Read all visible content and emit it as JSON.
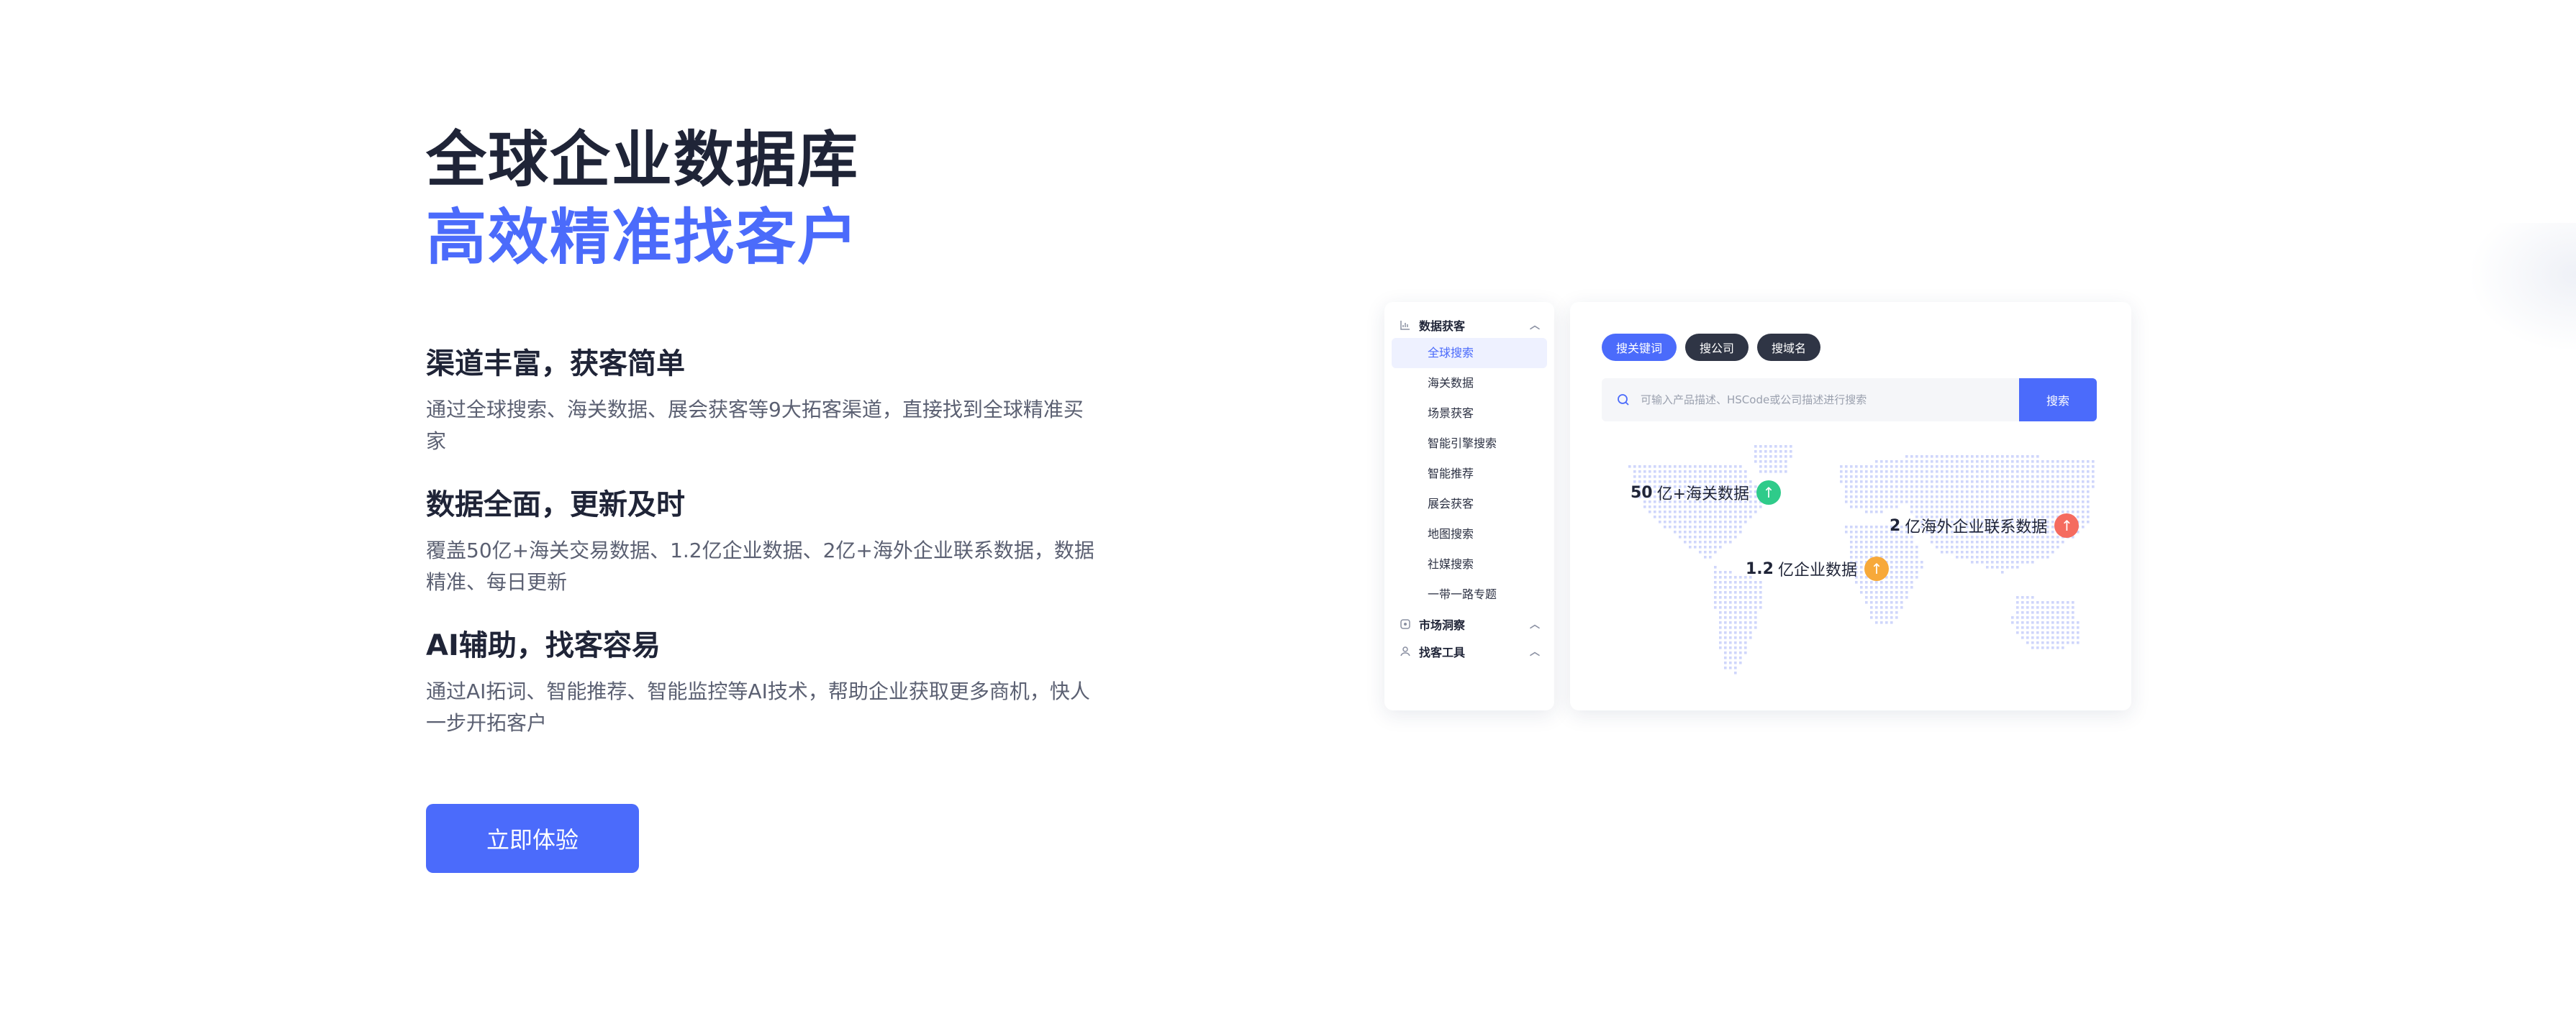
{
  "hero": {
    "title_line1": "全球企业数据库",
    "title_line2": "高效精准找客户",
    "cta_label": "立即体验"
  },
  "features": [
    {
      "title": "渠道丰富，获客简单",
      "desc": "通过全球搜索、海关数据、展会获客等9大拓客渠道，直接找到全球精准买家"
    },
    {
      "title": "数据全面，更新及时",
      "desc": "覆盖50亿+海关交易数据、1.2亿企业数据、2亿+海外企业联系数据，数据精准、每日更新"
    },
    {
      "title": "AI辅助，找客容易",
      "desc": "通过AI拓词、智能推荐、智能监控等AI技术，帮助企业获取更多商机，快人一步开拓客户"
    }
  ],
  "sidebar": {
    "group1": {
      "label": "数据获客",
      "icon": "bar-chart-icon"
    },
    "items": [
      "全球搜索",
      "海关数据",
      "场景获客",
      "智能引擎搜索",
      "智能推荐",
      "展会获客",
      "地图搜索",
      "社媒搜索",
      "一带一路专题"
    ],
    "active_index": 0,
    "group2": {
      "label": "市场洞察",
      "icon": "insight-icon"
    },
    "group3": {
      "label": "找客工具",
      "icon": "user-tool-icon"
    }
  },
  "panel": {
    "tabs": [
      "搜关键词",
      "搜公司",
      "搜域名"
    ],
    "active_tab": 0,
    "search_placeholder": "可输入产品描述、HSCode或公司描述进行搜索",
    "search_button": "搜索",
    "stats": [
      {
        "num": "50",
        "label": "亿+海关数据",
        "color": "#2fcb8a"
      },
      {
        "num": "2",
        "label": "亿海外企业联系数据",
        "color": "#f56b5f"
      },
      {
        "num": "1.2",
        "label": "亿企业数据",
        "color": "#f7a93a"
      }
    ]
  },
  "colors": {
    "brand": "#4b6bfb",
    "dark": "#1f2437",
    "text": "#5b6072"
  }
}
